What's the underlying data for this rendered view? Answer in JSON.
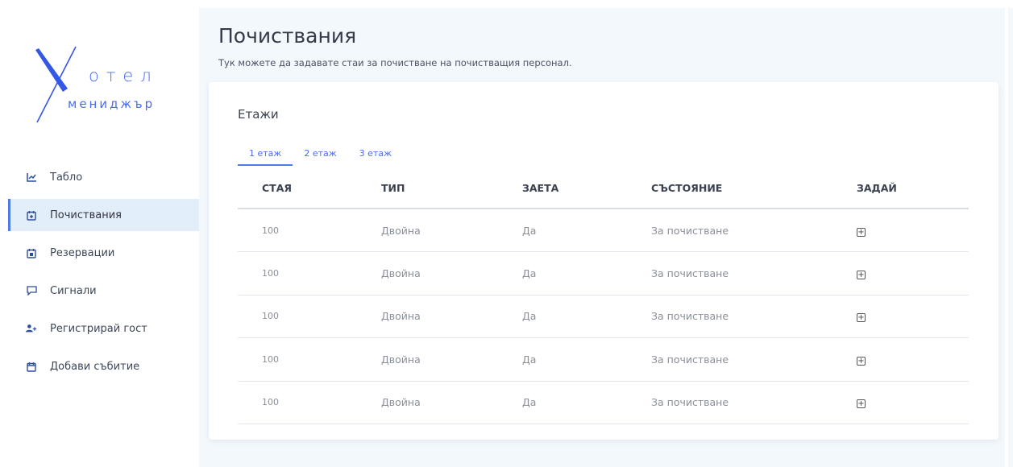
{
  "logo": {
    "top": "отел",
    "bottom": "мениджър"
  },
  "sidebar": {
    "items": [
      {
        "label": "Табло",
        "icon": "chart-line-icon",
        "active": false
      },
      {
        "label": "Почиствания",
        "icon": "calendar-plus-icon",
        "active": true
      },
      {
        "label": "Резервации",
        "icon": "calendar-check-icon",
        "active": false
      },
      {
        "label": "Сигнали",
        "icon": "comment-icon",
        "active": false
      },
      {
        "label": "Регистрирай гост",
        "icon": "user-plus-icon",
        "active": false
      },
      {
        "label": "Добави събитие",
        "icon": "calendar-icon",
        "active": false
      }
    ]
  },
  "page": {
    "title": "Почиствания",
    "subtitle": "Тук можете да задавате стаи за почистване на почистващия персонал."
  },
  "card": {
    "title": "Етажи",
    "tabs": [
      "1 етаж",
      "2 етаж",
      "3 етаж"
    ],
    "active_tab": 0
  },
  "table": {
    "headers": [
      "СТАЯ",
      "ТИП",
      "ЗАЕТА",
      "СЪСТОЯНИЕ",
      "ЗАДАЙ"
    ],
    "rows": [
      {
        "room": "100",
        "type": "Двойна",
        "occupied": "Да",
        "status": "За почистване"
      },
      {
        "room": "100",
        "type": "Двойна",
        "occupied": "Да",
        "status": "За почистване"
      },
      {
        "room": "100",
        "type": "Двойна",
        "occupied": "Да",
        "status": "За почистване"
      },
      {
        "room": "100",
        "type": "Двойна",
        "occupied": "Да",
        "status": "За почистване"
      },
      {
        "room": "100",
        "type": "Двойна",
        "occupied": "Да",
        "status": "За почистване"
      }
    ]
  },
  "colors": {
    "accent": "#4b6cf0",
    "active_bg": "#e3eefb",
    "main_bg": "#f3f8fd"
  }
}
